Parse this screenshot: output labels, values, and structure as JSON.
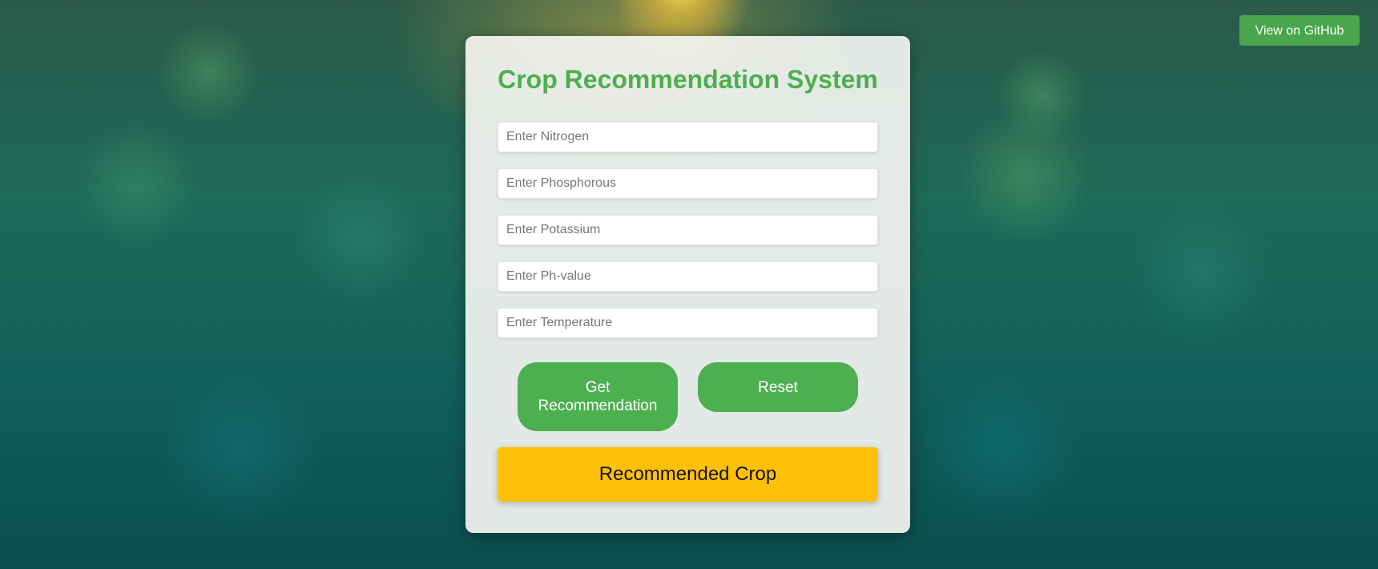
{
  "header": {
    "github_label": "View on GitHub"
  },
  "form": {
    "title": "Crop Recommendation System",
    "fields": [
      {
        "placeholder": "Enter Nitrogen",
        "value": ""
      },
      {
        "placeholder": "Enter Phosphorous",
        "value": ""
      },
      {
        "placeholder": "Enter Potassium",
        "value": ""
      },
      {
        "placeholder": "Enter Ph-value",
        "value": ""
      },
      {
        "placeholder": "Enter Temperature",
        "value": ""
      }
    ],
    "get_recommendation_label": "Get Recommendation",
    "reset_label": "Reset",
    "result_label": "Recommended Crop"
  },
  "colors": {
    "accent_green": "#4caf50",
    "result_yellow": "#ffc107",
    "github_green": "#4aa64e"
  }
}
